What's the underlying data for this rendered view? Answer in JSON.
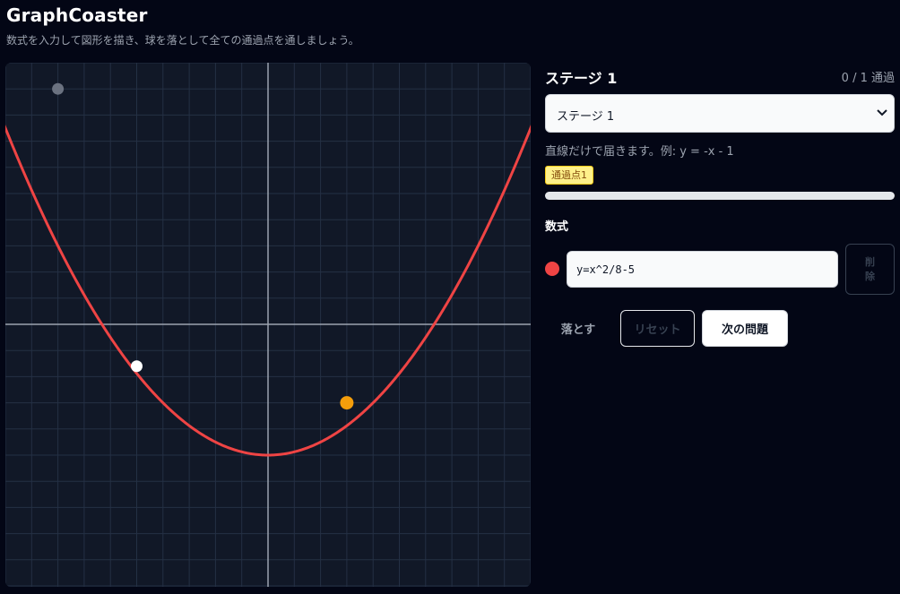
{
  "header": {
    "title": "GraphCoaster",
    "subtitle": "数式を入力して図形を描き、球を落として全ての通過点を通しましょう。"
  },
  "stage": {
    "title": "ステージ 1",
    "progress_text": "0 / 1 通過",
    "select_value": "ステージ 1",
    "hint": "直線だけで届きます。例: y = -x - 1",
    "badges": [
      "通過点1"
    ],
    "progress_fraction": 0
  },
  "formula": {
    "heading": "数式",
    "color": "#ef4444",
    "expression": "y=x^2/8-5",
    "delete_label": "削除"
  },
  "controls": {
    "drop_label": "落とす",
    "reset_label": "リセット",
    "next_label": "次の問題"
  },
  "graph": {
    "x_range": [
      -10,
      10
    ],
    "y_range": [
      -10,
      10
    ],
    "grid_step": 1,
    "curve_color": "#ef4444",
    "start_point": {
      "x": -8,
      "y": 9
    },
    "ball": {
      "x": -5,
      "y": -1.6
    },
    "checkpoint": {
      "x": 3,
      "y": -3
    },
    "start_color": "#6b7280",
    "ball_color": "#ffffff",
    "checkpoint_color": "#f59e0b"
  }
}
